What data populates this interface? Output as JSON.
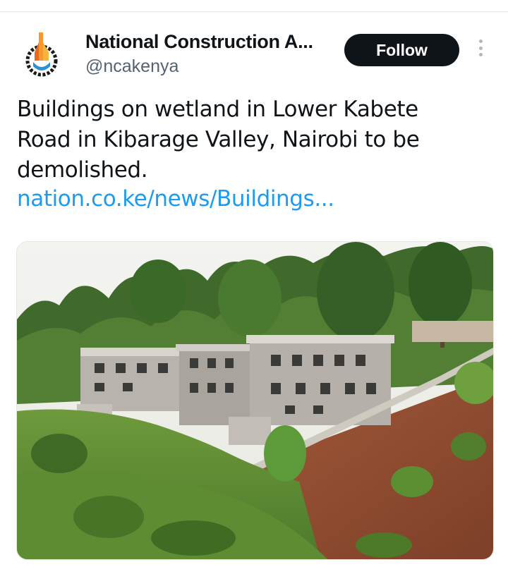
{
  "account": {
    "name": "National Construction A...",
    "handle": "@ncakenya",
    "follow_label": "Follow"
  },
  "tweet": {
    "text": "Buildings on wetland in Lower Kabete Road in Kibarage Valley, Nairobi to be demolished.",
    "link": "nation.co.ke/news/Buildings..."
  },
  "icons": {
    "avatar": "nca-logo-icon",
    "more": "more-dots-icon"
  },
  "colors": {
    "follow_bg": "#0f1419",
    "link": "#1d9bf0",
    "handle": "#536471"
  }
}
